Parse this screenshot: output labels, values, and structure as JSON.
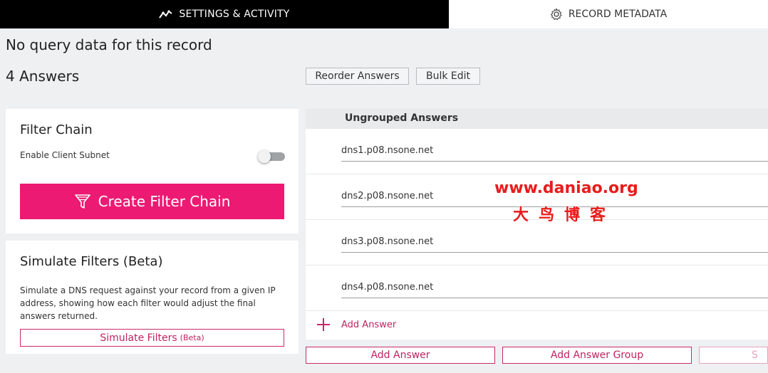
{
  "tabs": {
    "settings_label": "SETTINGS & ACTIVITY",
    "metadata_label": "RECORD METADATA"
  },
  "header": {
    "no_query_text": "No query data for this record",
    "answers_count": "4 Answers",
    "reorder_label": "Reorder Answers",
    "bulk_edit_label": "Bulk Edit"
  },
  "filter_chain": {
    "title": "Filter Chain",
    "subnet_label": "Enable Client Subnet",
    "subnet_enabled": false,
    "create_label": "Create Filter Chain"
  },
  "simulate": {
    "title": "Simulate Filters (Beta)",
    "description": "Simulate a DNS request against your record from a given IP address, showing how each filter would adjust the final answers returned.",
    "button_label": "Simulate Filters",
    "button_beta": "(Beta)"
  },
  "answers": {
    "group_label": "Ungrouped Answers",
    "items": [
      {
        "value": "dns1.p08.nsone.net"
      },
      {
        "value": "dns2.p08.nsone.net"
      },
      {
        "value": "dns3.p08.nsone.net"
      },
      {
        "value": "dns4.p08.nsone.net"
      }
    ],
    "add_inline_label": "Add Answer"
  },
  "footer": {
    "add_answer_label": "Add Answer",
    "add_group_label": "Add Answer Group",
    "third_label": "S"
  },
  "watermark": {
    "url": "www.daniao.org",
    "cn": "大鸟博客"
  },
  "colors": {
    "accent": "#ec1a73",
    "tab_active_bg": "#000000"
  }
}
